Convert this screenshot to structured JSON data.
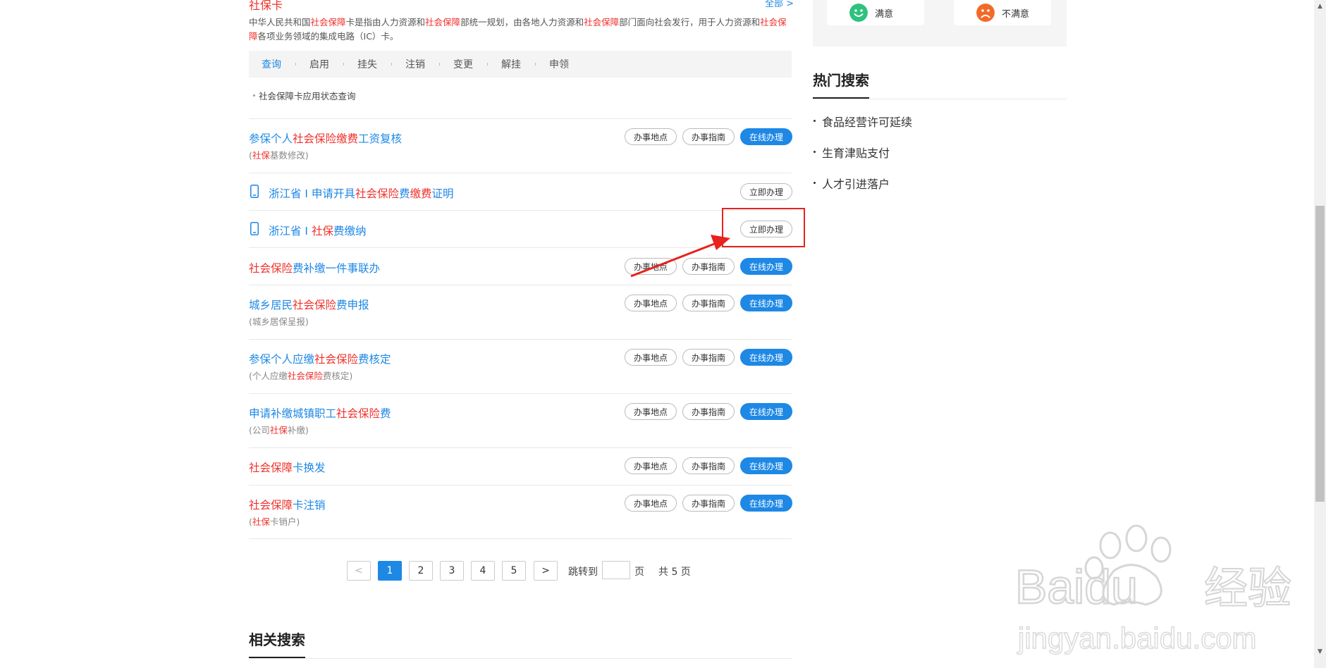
{
  "card": {
    "title": "社保卡",
    "more": "全部 >",
    "desc_parts": [
      "中华人民共和国",
      "社会保障",
      "卡是指由人力资源和",
      "社会保障",
      "部统一规划，由各地人力资源和",
      "社会保障",
      "部门面向社会发行，用于人力资源和",
      "社会保障",
      "各项业务领域的集成电路（IC）卡。"
    ],
    "tabs": [
      "查询",
      "启用",
      "挂失",
      "注销",
      "变更",
      "解挂",
      "申领"
    ],
    "sub_item": "社会保障卡应用状态查询"
  },
  "rows": [
    {
      "title_parts": [
        "参保个人",
        "社会保险缴费",
        "工资复核"
      ],
      "sub_parts": [
        "(",
        "社保",
        "基数修改)"
      ],
      "buttons": [
        "办事地点",
        "办事指南",
        "在线办理"
      ]
    },
    {
      "title_parts": [
        "浙江省 I 申请开具",
        "社会保险",
        "费",
        "缴费",
        "证明"
      ],
      "buttons": [
        "立即办理"
      ],
      "mobile": true
    },
    {
      "title_parts": [
        "浙江省 I ",
        "社保",
        "费",
        "缴纳"
      ],
      "buttons": [
        "立即办理"
      ],
      "mobile": true
    },
    {
      "title_parts": [
        "社会保险",
        "费补缴一件事联办"
      ],
      "buttons": [
        "办事地点",
        "办事指南",
        "在线办理"
      ]
    },
    {
      "title_parts": [
        "城乡居民",
        "社会保险",
        "费申报"
      ],
      "sub_parts": [
        "(城乡居保呈报)"
      ],
      "buttons": [
        "办事地点",
        "办事指南",
        "在线办理"
      ]
    },
    {
      "title_parts": [
        "参保个人应缴",
        "社会保险",
        "费核定"
      ],
      "sub_parts": [
        "(个人应缴",
        "社会保险",
        "费核定)"
      ],
      "buttons": [
        "办事地点",
        "办事指南",
        "在线办理"
      ]
    },
    {
      "title_parts": [
        "申请补缴城镇职工",
        "社会保险",
        "费"
      ],
      "sub_parts": [
        "(公司",
        "社保",
        "补缴)"
      ],
      "buttons": [
        "办事地点",
        "办事指南",
        "在线办理"
      ]
    },
    {
      "title_parts": [
        "社会保障",
        "卡换发"
      ],
      "buttons": [
        "办事地点",
        "办事指南",
        "在线办理"
      ]
    },
    {
      "title_parts": [
        "社会保障",
        "卡注销"
      ],
      "sub_parts": [
        "(",
        "社保",
        "卡销户)"
      ],
      "buttons": [
        "办事地点",
        "办事指南",
        "在线办理"
      ]
    }
  ],
  "pagination": {
    "prev": "<",
    "next": ">",
    "pages": [
      "1",
      "2",
      "3",
      "4",
      "5"
    ],
    "current": "1",
    "jump_label": "跳转到",
    "page_unit": "页",
    "total": "共 5 页"
  },
  "related": {
    "title": "相关搜索"
  },
  "sidebar": {
    "feedback": [
      {
        "label": "满意",
        "color": "#2ec27e"
      },
      {
        "label": "不满意",
        "color": "#f26a2a"
      }
    ],
    "hot_title": "热门搜索",
    "hot_items": [
      "食品经营许可延续",
      "生育津贴支付",
      "人才引进落户"
    ]
  },
  "watermark": {
    "brand": "Baidu",
    "product": "经验",
    "url": "jingyan.baidu.com"
  },
  "colors": {
    "link": "#1e88e5",
    "highlight": "#f0302b",
    "annotation": "#e8221d"
  }
}
